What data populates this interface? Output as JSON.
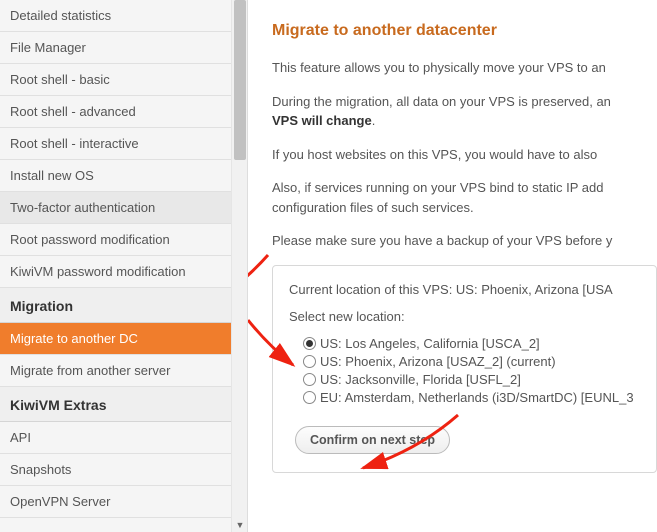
{
  "sidebar": {
    "items": [
      {
        "label": "Detailed statistics"
      },
      {
        "label": "File Manager"
      },
      {
        "label": "Root shell - basic"
      },
      {
        "label": "Root shell - advanced"
      },
      {
        "label": "Root shell - interactive"
      },
      {
        "label": "Install new OS"
      },
      {
        "label": "Two-factor authentication",
        "hover": true
      },
      {
        "label": "Root password modification"
      },
      {
        "label": "KiwiVM password modification"
      }
    ],
    "header1": "Migration",
    "items2": [
      {
        "label": "Migrate to another DC",
        "active": true
      },
      {
        "label": "Migrate from another server"
      }
    ],
    "header2": "KiwiVM Extras",
    "items3": [
      {
        "label": "API"
      },
      {
        "label": "Snapshots"
      },
      {
        "label": "OpenVPN Server"
      }
    ]
  },
  "main": {
    "title": "Migrate to another datacenter",
    "p1": "This feature allows you to physically move your VPS to an",
    "p2a": "During the migration, all data on your VPS is preserved, an",
    "p2b": "VPS will change",
    "p2c": ".",
    "p3": "If you host websites on this VPS, you would have to also",
    "p4": "Also, if services running on your VPS bind to static IP add",
    "p4b": "configuration files of such services.",
    "p5": "Please make sure you have a backup of your VPS before y",
    "box": {
      "current": "Current location of this VPS: US: Phoenix, Arizona [USA",
      "select_label": "Select new location:",
      "options": [
        {
          "label": "US: Los Angeles, California [USCA_2]",
          "selected": true
        },
        {
          "label": "US: Phoenix, Arizona [USAZ_2] (current)"
        },
        {
          "label": "US: Jacksonville, Florida [USFL_2]"
        },
        {
          "label": "EU: Amsterdam, Netherlands (i3D/SmartDC) [EUNL_3"
        }
      ],
      "confirm": "Confirm on next step"
    }
  }
}
